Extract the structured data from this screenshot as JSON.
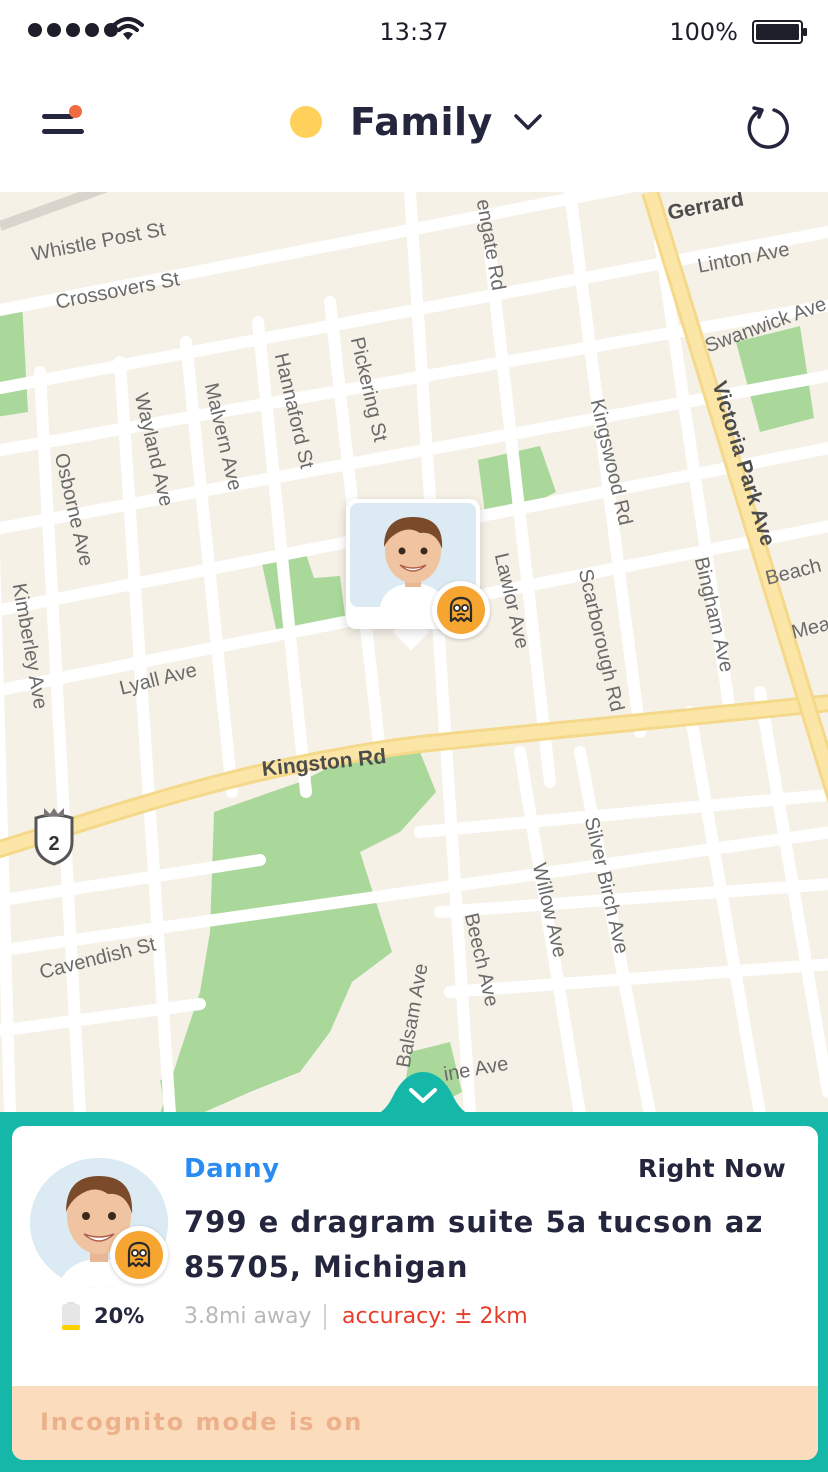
{
  "status_bar": {
    "time": "13:37",
    "battery": "100%"
  },
  "header": {
    "group_name": "Family",
    "group_color": "#ffd15b",
    "menu_icon": "menu-icon",
    "refresh_icon": "refresh-icon",
    "notification_dot_color": "#f26a3f"
  },
  "map": {
    "streets": [
      "Whistle Post St",
      "Crossovers St",
      "Osborne Ave",
      "Wayland Ave",
      "Malvern Ave",
      "Hannaford St",
      "Pickering St",
      "Kimberley Ave",
      "Lyall Ave",
      "Kingston Rd",
      "Cavendish St",
      "Balsam Ave",
      "Beech Ave",
      "Willow Ave",
      "Silver Birch Ave",
      "Scarborough Rd",
      "Lawlor Ave",
      "Kingswood Rd",
      "Bingham Ave",
      "Victoria Park Ave",
      "Gerrard",
      "Linton Ave",
      "Swanwick Ave",
      "Beach",
      "Mea",
      "engate Rd",
      "ine Ave"
    ],
    "highway_shield": "2",
    "marker_badge_icon": "ghost-icon"
  },
  "person": {
    "name": "Danny",
    "last_seen": "Right Now",
    "address": "799 e dragram suite 5a tucson az 85705, Michigan",
    "battery": "20%",
    "battery_level": 0.2,
    "distance": "3.8mi away",
    "accuracy": "accuracy: ± 2km",
    "incognito_message": "Incognito mode is on"
  },
  "colors": {
    "accent": "#15b8a8",
    "name": "#2a8cf0",
    "accuracy": "#e73c28",
    "incognito_bg": "#fbdcbd",
    "ghost_badge": "#f6a531"
  }
}
